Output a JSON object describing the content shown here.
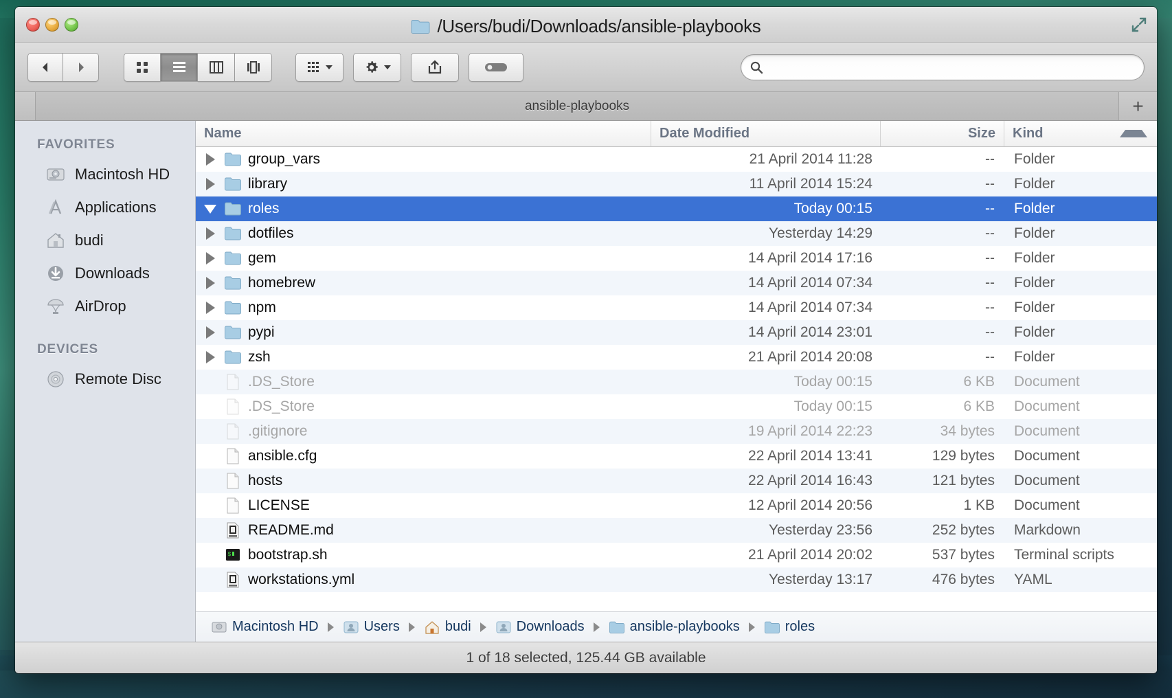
{
  "window": {
    "title": "/Users/budi/Downloads/ansible-playbooks",
    "tab_label": "ansible-playbooks",
    "new_tab_label": "+"
  },
  "toolbar": {
    "back_label": "Back",
    "forward_label": "Forward",
    "view_icon_label": "Icon view",
    "view_list_label": "List view",
    "view_column_label": "Column view",
    "view_coverflow_label": "Cover Flow view",
    "arrange_label": "Arrange",
    "action_label": "Action",
    "share_label": "Share",
    "tag_label": "Tags"
  },
  "search": {
    "value": "",
    "placeholder": ""
  },
  "sidebar": {
    "sections": [
      {
        "header": "FAVORITES",
        "items": [
          {
            "label": "Macintosh HD",
            "icon": "harddisk-icon"
          },
          {
            "label": "Applications",
            "icon": "applications-icon"
          },
          {
            "label": "budi",
            "icon": "home-icon"
          },
          {
            "label": "Downloads",
            "icon": "downloads-icon"
          },
          {
            "label": "AirDrop",
            "icon": "airdrop-icon"
          }
        ]
      },
      {
        "header": "DEVICES",
        "items": [
          {
            "label": "Remote Disc",
            "icon": "disc-icon"
          }
        ]
      }
    ]
  },
  "columns": {
    "name": "Name",
    "date": "Date Modified",
    "size": "Size",
    "kind": "Kind",
    "sort_direction": "ascending"
  },
  "files": [
    {
      "name": "group_vars",
      "date": "21 April 2014 11:28",
      "size": "--",
      "kind": "Folder",
      "icon": "folder-icon",
      "indent": 0,
      "disclosure": "closed",
      "selected": false,
      "dim": false
    },
    {
      "name": "library",
      "date": "11 April 2014 15:24",
      "size": "--",
      "kind": "Folder",
      "icon": "folder-icon",
      "indent": 0,
      "disclosure": "closed",
      "selected": false,
      "dim": false
    },
    {
      "name": "roles",
      "date": "Today 00:15",
      "size": "--",
      "kind": "Folder",
      "icon": "folder-icon",
      "indent": 0,
      "disclosure": "open",
      "selected": true,
      "dim": false
    },
    {
      "name": "dotfiles",
      "date": "Yesterday 14:29",
      "size": "--",
      "kind": "Folder",
      "icon": "folder-icon",
      "indent": 1,
      "disclosure": "closed",
      "selected": false,
      "dim": false
    },
    {
      "name": "gem",
      "date": "14 April 2014 17:16",
      "size": "--",
      "kind": "Folder",
      "icon": "folder-icon",
      "indent": 1,
      "disclosure": "closed",
      "selected": false,
      "dim": false
    },
    {
      "name": "homebrew",
      "date": "14 April 2014 07:34",
      "size": "--",
      "kind": "Folder",
      "icon": "folder-icon",
      "indent": 1,
      "disclosure": "closed",
      "selected": false,
      "dim": false
    },
    {
      "name": "npm",
      "date": "14 April 2014 07:34",
      "size": "--",
      "kind": "Folder",
      "icon": "folder-icon",
      "indent": 1,
      "disclosure": "closed",
      "selected": false,
      "dim": false
    },
    {
      "name": "pypi",
      "date": "14 April 2014 23:01",
      "size": "--",
      "kind": "Folder",
      "icon": "folder-icon",
      "indent": 1,
      "disclosure": "closed",
      "selected": false,
      "dim": false
    },
    {
      "name": "zsh",
      "date": "21 April 2014 20:08",
      "size": "--",
      "kind": "Folder",
      "icon": "folder-icon",
      "indent": 1,
      "disclosure": "closed",
      "selected": false,
      "dim": false
    },
    {
      "name": ".DS_Store",
      "date": "Today 00:15",
      "size": "6 KB",
      "kind": "Document",
      "icon": "document-icon",
      "indent": 2,
      "disclosure": "none",
      "selected": false,
      "dim": true
    },
    {
      "name": ".DS_Store",
      "date": "Today 00:15",
      "size": "6 KB",
      "kind": "Document",
      "icon": "document-icon",
      "indent": 0,
      "disclosure": "none",
      "selected": false,
      "dim": true
    },
    {
      "name": ".gitignore",
      "date": "19 April 2014 22:23",
      "size": "34 bytes",
      "kind": "Document",
      "icon": "document-icon",
      "indent": 0,
      "disclosure": "none",
      "selected": false,
      "dim": true
    },
    {
      "name": "ansible.cfg",
      "date": "22 April 2014 13:41",
      "size": "129 bytes",
      "kind": "Document",
      "icon": "document-icon",
      "indent": 0,
      "disclosure": "none",
      "selected": false,
      "dim": false
    },
    {
      "name": "hosts",
      "date": "22 April 2014 16:43",
      "size": "121 bytes",
      "kind": "Document",
      "icon": "document-icon",
      "indent": 0,
      "disclosure": "none",
      "selected": false,
      "dim": false
    },
    {
      "name": "LICENSE",
      "date": "12 April 2014 20:56",
      "size": "1 KB",
      "kind": "Document",
      "icon": "document-icon",
      "indent": 0,
      "disclosure": "none",
      "selected": false,
      "dim": false
    },
    {
      "name": "README.md",
      "date": "Yesterday 23:56",
      "size": "252 bytes",
      "kind": "Markdown",
      "icon": "markdown-icon",
      "indent": 0,
      "disclosure": "none",
      "selected": false,
      "dim": false
    },
    {
      "name": "bootstrap.sh",
      "date": "21 April 2014 20:02",
      "size": "537 bytes",
      "kind": "Terminal scripts",
      "icon": "terminal-icon",
      "indent": 0,
      "disclosure": "none",
      "selected": false,
      "dim": false
    },
    {
      "name": "workstations.yml",
      "date": "Yesterday 13:17",
      "size": "476 bytes",
      "kind": "YAML",
      "icon": "yaml-icon",
      "indent": 0,
      "disclosure": "none",
      "selected": false,
      "dim": false
    }
  ],
  "pathbar": [
    {
      "label": "Macintosh HD",
      "icon": "harddisk-icon"
    },
    {
      "label": "Users",
      "icon": "users-folder-icon"
    },
    {
      "label": "budi",
      "icon": "home-icon"
    },
    {
      "label": "Downloads",
      "icon": "downloads-folder-icon"
    },
    {
      "label": "ansible-playbooks",
      "icon": "folder-icon"
    },
    {
      "label": "roles",
      "icon": "folder-icon"
    }
  ],
  "statusbar": {
    "text": "1 of 18 selected, 125.44 GB available"
  },
  "colors": {
    "selection": "#3b72d4",
    "sidebar_bg": "#dfe3ea",
    "alt_row": "#f2f6fb",
    "folder_blue": "#9cc3de"
  }
}
